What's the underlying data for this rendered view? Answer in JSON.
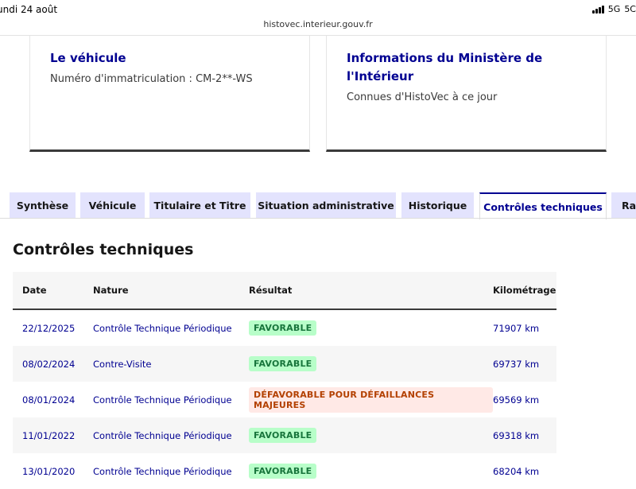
{
  "status_bar": {
    "time": "undi 24 août",
    "network": "5G",
    "battery": "5C",
    "url": "histovec.interieur.gouv.fr"
  },
  "cards": [
    {
      "title": "Le véhicule",
      "text": "Numéro d'immatriculation : CM-2**-WS"
    },
    {
      "title": "Informations du Ministère de l'Intérieur",
      "text": "Connues d'HistoVec à ce jour"
    }
  ],
  "tabs": [
    {
      "label": "Synthèse",
      "active": false
    },
    {
      "label": "Véhicule",
      "active": false
    },
    {
      "label": "Titulaire et Titre",
      "active": false
    },
    {
      "label": "Situation administrative",
      "active": false
    },
    {
      "label": "Historique",
      "active": false
    },
    {
      "label": "Contrôles techniques",
      "active": true
    },
    {
      "label": "Rap",
      "active": false
    }
  ],
  "section": {
    "title": "Contrôles techniques",
    "columns": [
      "Date",
      "Nature",
      "Résultat",
      "Kilométrage"
    ],
    "rows": [
      {
        "date": "22/12/2025",
        "nature": "Contrôle Technique Périodique",
        "result": "FAVORABLE",
        "status": "ok",
        "km": "71907 km"
      },
      {
        "date": "08/02/2024",
        "nature": "Contre-Visite",
        "result": "FAVORABLE",
        "status": "ok",
        "km": "69737 km"
      },
      {
        "date": "08/01/2024",
        "nature": "Contrôle Technique Périodique",
        "result": "DÉFAVORABLE POUR DÉFAILLANCES MAJEURES",
        "status": "ko",
        "km": "69569 km"
      },
      {
        "date": "11/01/2022",
        "nature": "Contrôle Technique Périodique",
        "result": "FAVORABLE",
        "status": "ok",
        "km": "69318 km"
      },
      {
        "date": "13/01/2020",
        "nature": "Contrôle Technique Périodique",
        "result": "FAVORABLE",
        "status": "ok",
        "km": "68204 km"
      }
    ]
  },
  "colors": {
    "brand_blue": "#000091",
    "tab_background": "#e3e3fd",
    "success_bg": "#b8fec9",
    "success_text": "#18753c",
    "error_bg": "#ffe9e6",
    "error_text": "#b34000"
  }
}
